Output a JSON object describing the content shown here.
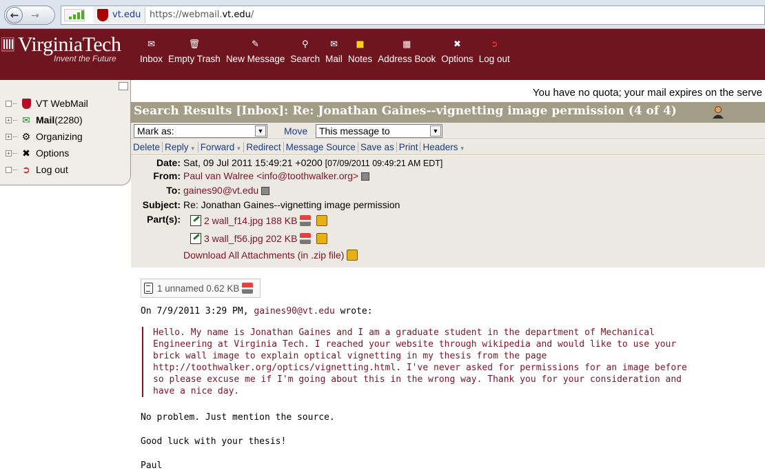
{
  "browser": {
    "site_badge": "vt.edu",
    "url_prefix": "https://webmail.",
    "url_domain": "vt.edu",
    "url_suffix": "/"
  },
  "header": {
    "logo_title": "VirginiaTech",
    "logo_subtitle": "Invent the Future",
    "brand_color": "#6f1520",
    "toolbar": [
      {
        "label": "Inbox",
        "icon": "envelope-icon"
      },
      {
        "label": "Empty Trash",
        "icon": "trash-icon"
      },
      {
        "label": "New Message",
        "icon": "compose-icon"
      },
      {
        "label": "Search",
        "icon": "magnifier-icon"
      },
      {
        "label": "Mail",
        "icon": "mail-icon"
      },
      {
        "label": "Notes",
        "icon": "notes-icon"
      },
      {
        "label": "Address Book",
        "icon": "address-book-icon"
      },
      {
        "label": "Options",
        "icon": "tools-icon"
      },
      {
        "label": "Log out",
        "icon": "logout-icon"
      }
    ]
  },
  "sidebar": {
    "items": [
      {
        "label": "VT WebMail",
        "count": "",
        "expander": ""
      },
      {
        "label": "Mail",
        "count": " (2280)",
        "expander": "+"
      },
      {
        "label": "Organizing",
        "count": "",
        "expander": "+"
      },
      {
        "label": "Options",
        "count": "",
        "expander": "+"
      },
      {
        "label": "Log out",
        "count": "",
        "expander": ""
      }
    ]
  },
  "main": {
    "quota_notice": "You have no quota; your mail expires on the serve",
    "title": "Search Results [Inbox]: Re: Jonathan Gaines--vignetting image permission (4 of 4)",
    "mark_as": "Mark as:",
    "move_label": "Move",
    "move_target": "This message to",
    "commands": [
      "Delete",
      "Reply",
      "Forward",
      "Redirect",
      "Message Source",
      "Save as",
      "Print",
      "Headers"
    ],
    "headers": {
      "date_label": "Date:",
      "date_value": "Sat, 09 Jul 2011 15:49:21 +0200",
      "date_local": "[07/09/2011 09:49:21 AM EDT]",
      "from_label": "From:",
      "from_value": "Paul van Walree <info@toothwalker.org>",
      "to_label": "To:",
      "to_value": "gaines90@vt.edu",
      "subject_label": "Subject:",
      "subject_value": "Re: Jonathan Gaines--vignetting image permission",
      "parts_label": "Part(s):",
      "parts": [
        {
          "text": "2 wall_f14.jpg 188 KB"
        },
        {
          "text": "3 wall_f56.jpg 202 KB"
        }
      ],
      "download_all": "Download All Attachments (in .zip file)"
    },
    "body": {
      "attachment_chip": "1 unnamed 0.62 KB",
      "wrote_prefix": "On 7/9/2011 3:29 PM, ",
      "wrote_email": "gaines90@vt.edu",
      "wrote_suffix": " wrote:",
      "quote": "Hello. My name is Jonathan Gaines and I am a graduate student in the department of Mechanical\nEngineering at Virginia Tech. I reached your website through wikipedia and would like to use your\nbrick wall image to explain optical vignetting in my thesis from the page\nhttp://toothwalker.org/optics/vignetting.html. I've never asked for permissions for an image before\nso please excuse me if I'm going about this in the wrong way. Thank you for your consideration and\nhave a nice day.",
      "line1": "No problem. Just mention the source.",
      "line2": "Good luck with your thesis!",
      "line3": "Paul"
    }
  }
}
